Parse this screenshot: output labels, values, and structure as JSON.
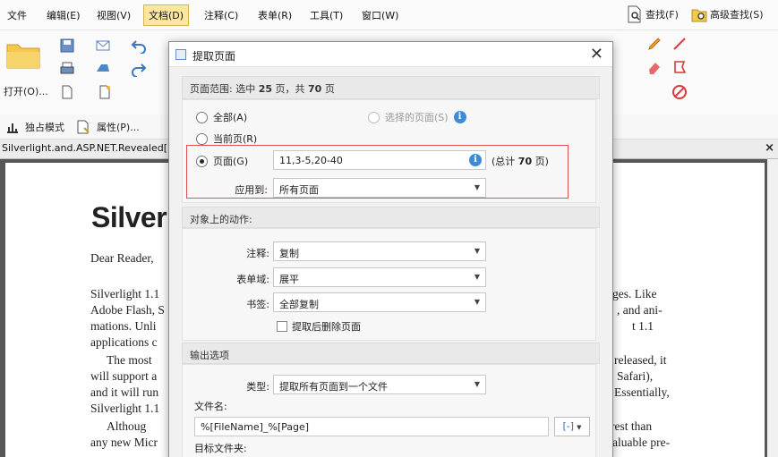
{
  "menubar": {
    "items": [
      "文件",
      "编辑(E)",
      "视图(V)",
      "文档(D)",
      "注释(C)",
      "表单(R)",
      "工具(T)",
      "窗口(W)"
    ],
    "search_label": "查找(F)",
    "advanced_search_label": "高级查找(S)"
  },
  "ribbon": {
    "open_label": "打开(O)...",
    "exclusive_mode_label": "独占模式",
    "properties_label": "属性(P)..."
  },
  "tabbar": {
    "doc_tab": "Silverlight.and.ASP.NET.Revealed[",
    "close": "×"
  },
  "document": {
    "title": "Silverl",
    "lines_left": [
      "Dear Reader,",
      "Silverlight 1.1",
      "Adobe Flash, S",
      "mations. Unli",
      "applications c",
      "The most",
      "will support a",
      "and it will run",
      "Silverlight 1.1",
      "Althoug",
      "any new Micr"
    ],
    "lines_right": [
      "ges. Like",
      ", and ani-",
      "t 1.1",
      "released, it",
      "Safari),",
      "Essentially,",
      "rest than",
      "aluable pre-"
    ]
  },
  "dialog": {
    "title": "提取页面",
    "close": "✕",
    "range_section": {
      "prefix": "页面范围: 选中 ",
      "selected": "25",
      "middle": " 页，共 ",
      "total": "70",
      "suffix": " 页"
    },
    "radio_all": "全部(A)",
    "radio_selected": "选择的页面(S)",
    "radio_current": "当前页(R)",
    "radio_pages": "页面(G)",
    "pages_value": "11,3-5,20-40",
    "total_pages_note_prefix": "(总计 ",
    "total_pages_note_num": "70",
    "total_pages_note_suffix": " 页)",
    "apply_to_label": "应用到:",
    "apply_to_value": "所有页面",
    "actions_head": "对象上的动作:",
    "comments_label": "注释:",
    "comments_value": "复制",
    "forms_label": "表单域:",
    "forms_value": "展平",
    "bookmarks_label": "书签:",
    "bookmarks_value": "全部复制",
    "delete_after_label": "提取后删除页面",
    "output_head": "输出选项",
    "type_label": "类型:",
    "type_value": "提取所有页面到一个文件",
    "filename_label": "文件名:",
    "filename_value": "%[FileName]_%[Page]",
    "macro_btn": "[-]",
    "target_folder_label": "目标文件夹:"
  },
  "colors": {
    "menu_active": "#fbe7a2",
    "highlight_border": "#e05050",
    "info_icon": "#3d8bd8"
  }
}
